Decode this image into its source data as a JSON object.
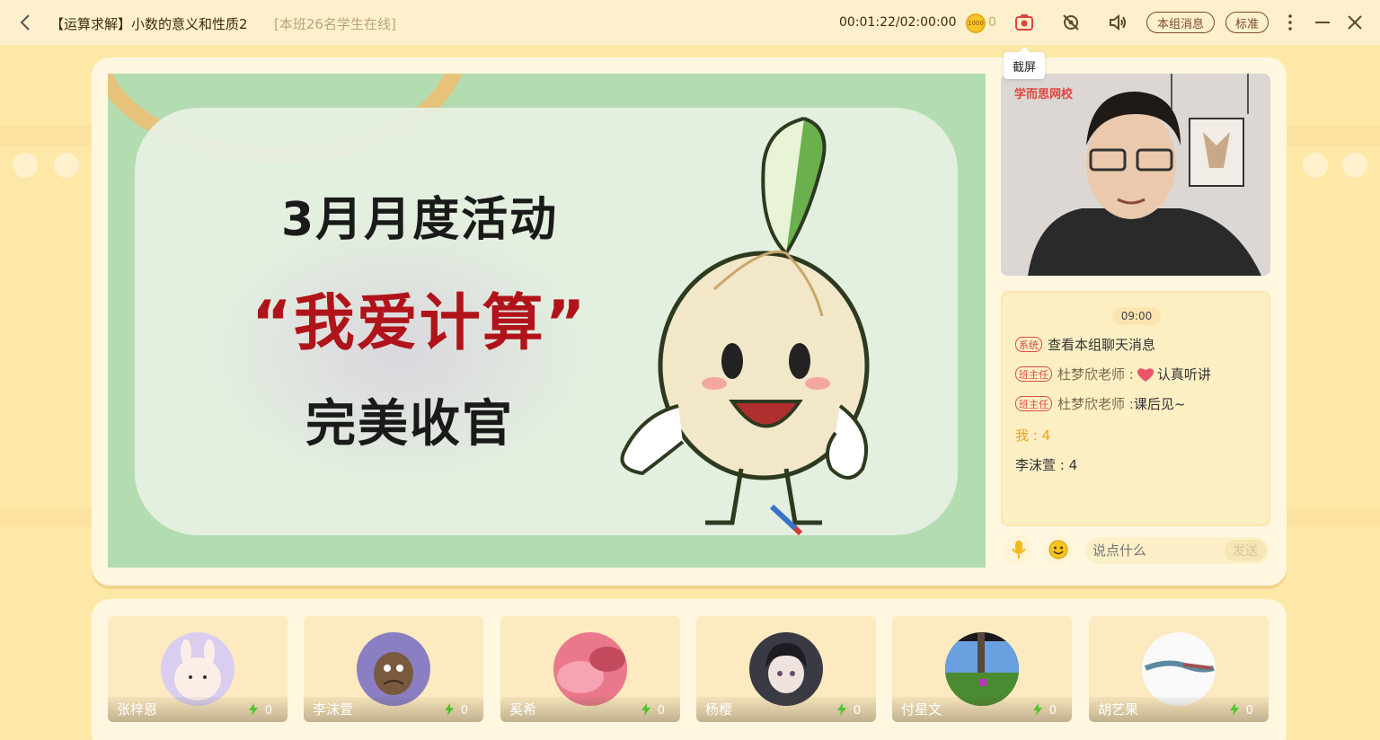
{
  "header": {
    "title": "【运算求解】小数的意义和性质2",
    "online_text": "[本班26名学生在线]",
    "timer": "00:01:22/02:00:00",
    "coin_label": "1000",
    "coin_count": "0",
    "group_msg_label": "本组消息",
    "quality_label": "标准",
    "tooltip": "截屏"
  },
  "slide": {
    "line1": "3月月度活动",
    "line2": "“我爱计算”",
    "line3": "完美收官"
  },
  "teacher": {
    "logo": "学而思网校"
  },
  "chat": {
    "time": "09:00",
    "messages": [
      {
        "tag": "系统",
        "text": "查看本组聊天消息"
      },
      {
        "tag": "班主任",
        "sender": "杜梦欣老师 : ",
        "text": "认真听讲"
      },
      {
        "tag": "班主任",
        "sender": "杜梦欣老师 : ",
        "text": "课后见~"
      }
    ],
    "me_line": "我 : 4",
    "other_line": "李沫萱 : 4",
    "input_placeholder": "说点什么",
    "send_label": "发送"
  },
  "students": [
    {
      "name": "张梓恩",
      "energy": "0"
    },
    {
      "name": "李沫萱",
      "energy": "0"
    },
    {
      "name": "奚希",
      "energy": "0"
    },
    {
      "name": "杨樱",
      "energy": "0"
    },
    {
      "name": "付星文",
      "energy": "0"
    },
    {
      "name": "胡艺果",
      "energy": "0"
    }
  ],
  "colors": {
    "background": "#fde8a8",
    "accent_red": "#d94a4a",
    "me_color": "#f0a020"
  }
}
